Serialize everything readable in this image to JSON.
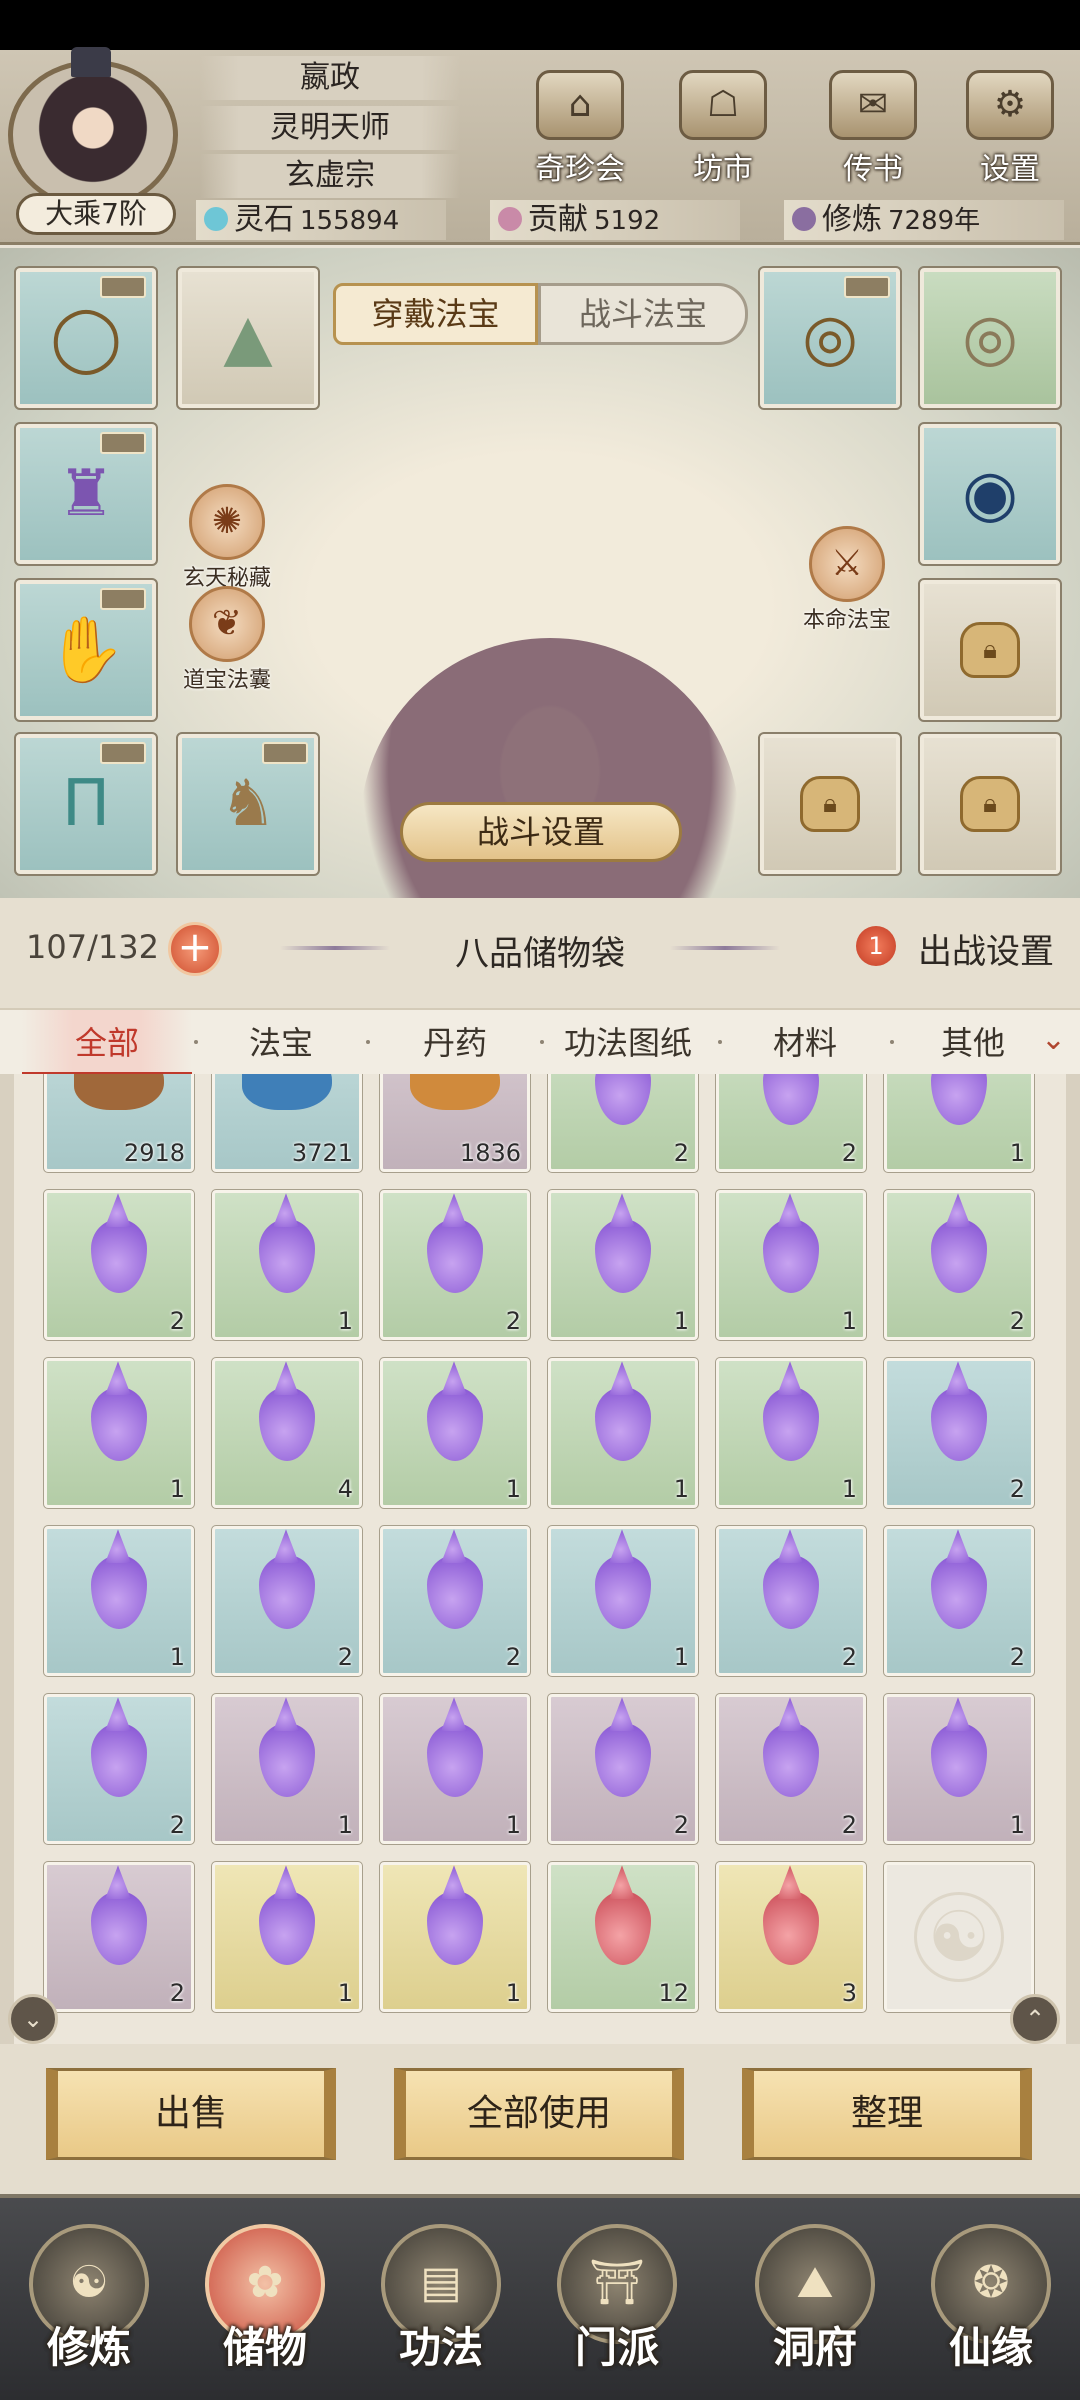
{
  "player": {
    "name": "嬴政",
    "title": "灵明天师",
    "sect": "玄虚宗",
    "rank": "大乘7阶"
  },
  "top_menu": [
    {
      "label": "奇珍会",
      "icon": "pavilion-icon"
    },
    {
      "label": "坊市",
      "icon": "market-stall-icon"
    },
    {
      "label": "传书",
      "icon": "scroll-letter-icon"
    },
    {
      "label": "设置",
      "icon": "gear-icon"
    }
  ],
  "resources": {
    "spirit_stone": {
      "label": "灵石",
      "value": "155894",
      "icon": "spirit-stone-icon",
      "color": "#6ec6d6"
    },
    "contribution": {
      "label": "贡献",
      "value": "5192",
      "icon": "contribution-gem-icon",
      "color": "#c98aa8"
    },
    "cultivation": {
      "label": "修炼",
      "value": "7289年",
      "icon": "meditation-icon",
      "color": "#8a6ea0"
    }
  },
  "equipment": {
    "tabs": [
      "穿戴法宝",
      "战斗法宝"
    ],
    "active_tab": "穿戴法宝",
    "left_slots": [
      {
        "icon": "necklace-icon"
      },
      {
        "icon": "robe-icon"
      },
      {
        "icon": "gauntlet-icon"
      },
      {
        "icon": "pants-icon"
      }
    ],
    "extra_slots": [
      {
        "icon": "hat-icon"
      },
      {
        "icon": "boots-icon"
      }
    ],
    "right_slots": [
      {
        "icon": "gold-ring-icon"
      },
      {
        "icon": "jade-ring-icon"
      },
      {
        "icon": "sapphire-ring-icon"
      }
    ],
    "mini_buttons": {
      "xuantian": "玄天秘藏",
      "daobao": "道宝法囊",
      "benming": "本命法宝"
    },
    "fight_settings": "战斗设置"
  },
  "bag": {
    "capacity": "107/132",
    "name": "八品储物袋",
    "deploy_count": "1",
    "deploy_label": "出战设置"
  },
  "filter_tabs": [
    "全部",
    "法宝",
    "丹药",
    "功法图纸",
    "材料",
    "其他"
  ],
  "active_filter": "全部",
  "items_partial_row": [
    {
      "kind": "rock-brown",
      "count": "2918",
      "bg": "blue"
    },
    {
      "kind": "rock-blue",
      "count": "3721",
      "bg": "blue"
    },
    {
      "kind": "rock-orange",
      "count": "1836",
      "bg": "purple"
    },
    {
      "kind": "drop",
      "count": "2",
      "bg": "green"
    },
    {
      "kind": "drop",
      "count": "2",
      "bg": "green"
    },
    {
      "kind": "drop",
      "count": "1",
      "bg": "green"
    }
  ],
  "items": [
    [
      {
        "c": "2",
        "bg": "green"
      },
      {
        "c": "1",
        "bg": "green"
      },
      {
        "c": "2",
        "bg": "green"
      },
      {
        "c": "1",
        "bg": "green"
      },
      {
        "c": "1",
        "bg": "green"
      },
      {
        "c": "2",
        "bg": "green"
      }
    ],
    [
      {
        "c": "1",
        "bg": "green"
      },
      {
        "c": "4",
        "bg": "green"
      },
      {
        "c": "1",
        "bg": "green"
      },
      {
        "c": "1",
        "bg": "green"
      },
      {
        "c": "1",
        "bg": "green"
      },
      {
        "c": "2",
        "bg": "blue"
      }
    ],
    [
      {
        "c": "1",
        "bg": "blue"
      },
      {
        "c": "2",
        "bg": "blue"
      },
      {
        "c": "2",
        "bg": "blue"
      },
      {
        "c": "1",
        "bg": "blue"
      },
      {
        "c": "2",
        "bg": "blue"
      },
      {
        "c": "2",
        "bg": "blue"
      }
    ],
    [
      {
        "c": "2",
        "bg": "blue"
      },
      {
        "c": "1",
        "bg": "purple"
      },
      {
        "c": "1",
        "bg": "purple"
      },
      {
        "c": "2",
        "bg": "purple"
      },
      {
        "c": "2",
        "bg": "purple"
      },
      {
        "c": "1",
        "bg": "purple"
      }
    ],
    [
      {
        "c": "2",
        "bg": "purple"
      },
      {
        "c": "1",
        "bg": "yellow"
      },
      {
        "c": "1",
        "bg": "yellow"
      },
      {
        "c": "12",
        "bg": "green",
        "red": true
      },
      {
        "c": "3",
        "bg": "yellow",
        "red": true
      },
      {
        "c": "",
        "bg": "empty"
      }
    ]
  ],
  "actions": {
    "sell": "出售",
    "use_all": "全部使用",
    "sort": "整理"
  },
  "bottom_nav": [
    {
      "label": "修炼",
      "icon": "cultivate-icon"
    },
    {
      "label": "储物",
      "icon": "storage-bag-icon"
    },
    {
      "label": "功法",
      "icon": "manual-scroll-icon"
    },
    {
      "label": "门派",
      "icon": "sect-gate-icon"
    },
    {
      "label": "洞府",
      "icon": "cave-mountain-icon"
    },
    {
      "label": "仙缘",
      "icon": "fate-swirl-icon"
    }
  ],
  "active_nav": "储物"
}
